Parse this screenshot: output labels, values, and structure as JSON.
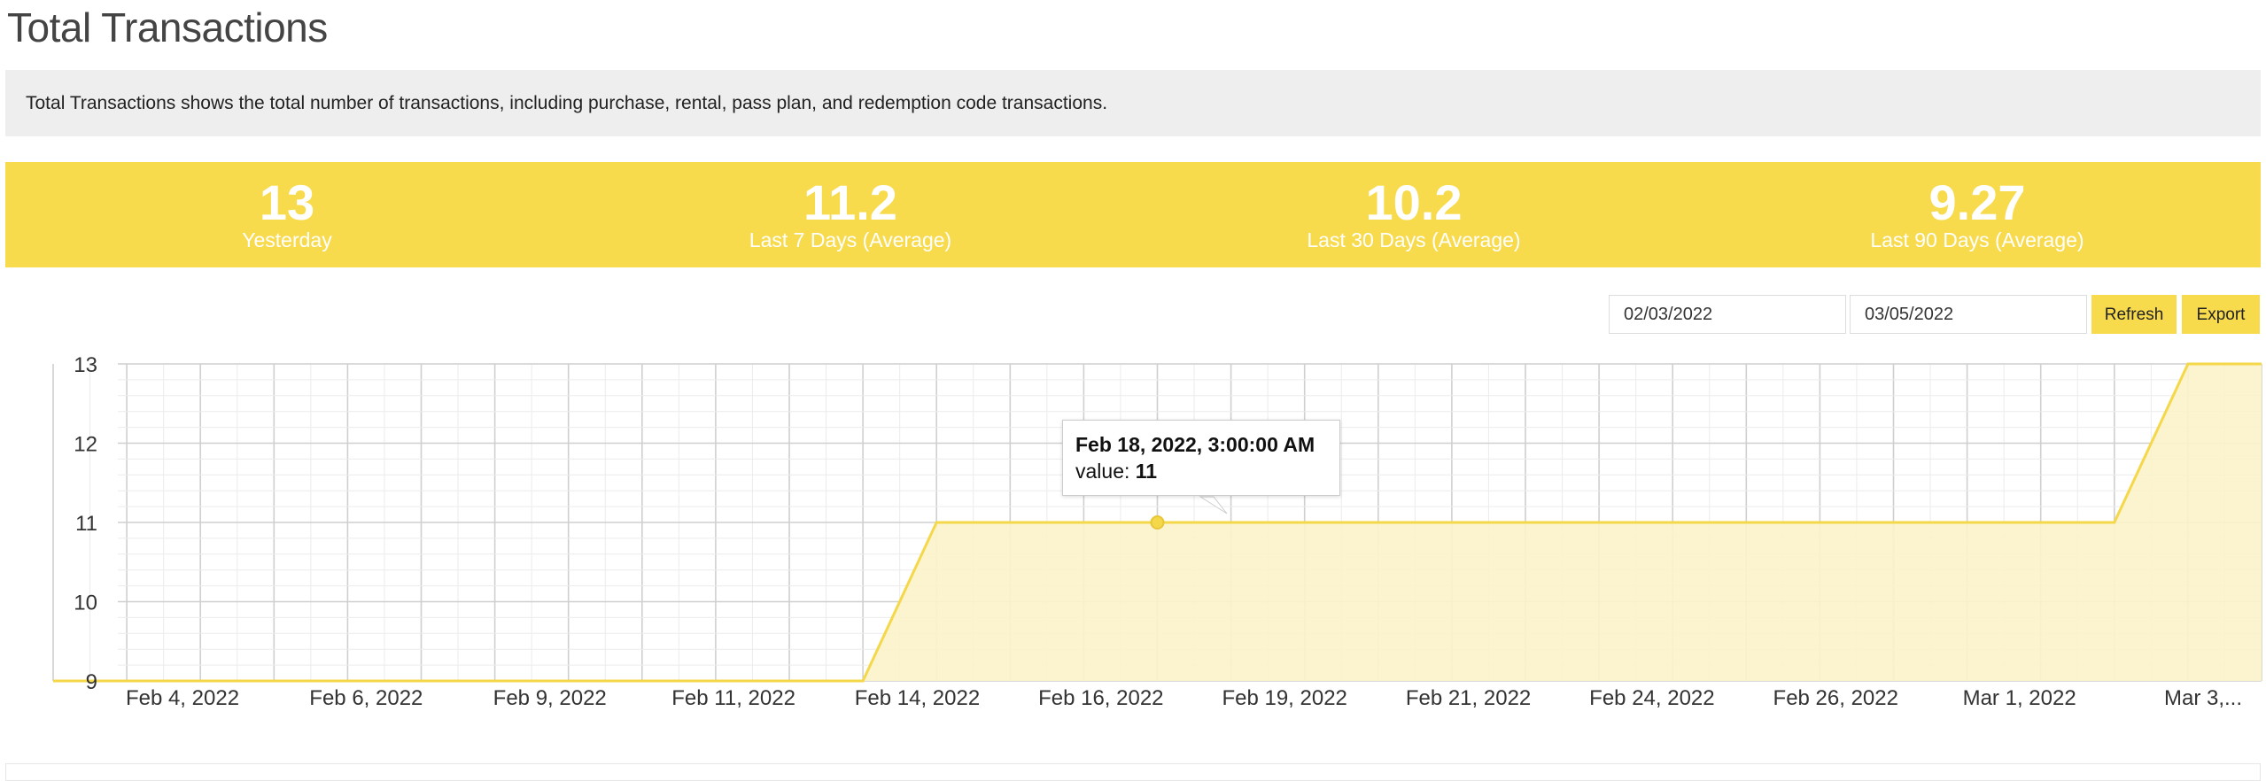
{
  "page": {
    "title": "Total Transactions",
    "description": "Total Transactions shows the total number of transactions, including purchase, rental, pass plan, and redemption code transactions."
  },
  "stats": [
    {
      "value": "13",
      "label": "Yesterday"
    },
    {
      "value": "11.2",
      "label": "Last 7 Days (Average)"
    },
    {
      "value": "10.2",
      "label": "Last 30 Days (Average)"
    },
    {
      "value": "9.27",
      "label": "Last 90 Days (Average)"
    }
  ],
  "controls": {
    "start_date": "02/03/2022",
    "end_date": "03/05/2022",
    "refresh_label": "Refresh",
    "export_label": "Export"
  },
  "colors": {
    "accent": "#f8db4d",
    "line": "#f5d74a",
    "area": "#fcf3c9",
    "grid": "#dddddd"
  },
  "tooltip": {
    "title": "Feb 18, 2022, 3:00:00 AM",
    "value_label": "value:",
    "value": "11"
  },
  "chart_data": {
    "type": "area",
    "x": [
      "2022-02-03",
      "2022-02-04",
      "2022-02-05",
      "2022-02-06",
      "2022-02-07",
      "2022-02-08",
      "2022-02-09",
      "2022-02-10",
      "2022-02-11",
      "2022-02-12",
      "2022-02-13",
      "2022-02-14",
      "2022-02-15",
      "2022-02-16",
      "2022-02-17",
      "2022-02-18",
      "2022-02-19",
      "2022-02-20",
      "2022-02-21",
      "2022-02-22",
      "2022-02-23",
      "2022-02-24",
      "2022-02-25",
      "2022-02-26",
      "2022-02-27",
      "2022-02-28",
      "2022-03-01",
      "2022-03-02",
      "2022-03-03",
      "2022-03-04",
      "2022-03-05"
    ],
    "values": [
      9,
      9,
      9,
      9,
      9,
      9,
      9,
      9,
      9,
      9,
      9,
      9,
      11,
      11,
      11,
      11,
      11,
      11,
      11,
      11,
      11,
      11,
      11,
      11,
      11,
      11,
      11,
      11,
      11,
      13,
      13
    ],
    "x_tick_labels": [
      "Feb 4, 2022",
      "Feb 6, 2022",
      "Feb 9, 2022",
      "Feb 11, 2022",
      "Feb 14, 2022",
      "Feb 16, 2022",
      "Feb 19, 2022",
      "Feb 21, 2022",
      "Feb 24, 2022",
      "Feb 26, 2022",
      "Mar 1, 2022",
      "Mar 3,..."
    ],
    "y_ticks": [
      9,
      10,
      11,
      12,
      13
    ],
    "ylim": [
      9,
      13
    ],
    "highlighted_point": {
      "x": "2022-02-18",
      "y": 11
    },
    "grid": true,
    "xlabel": "",
    "ylabel": "",
    "title": ""
  }
}
